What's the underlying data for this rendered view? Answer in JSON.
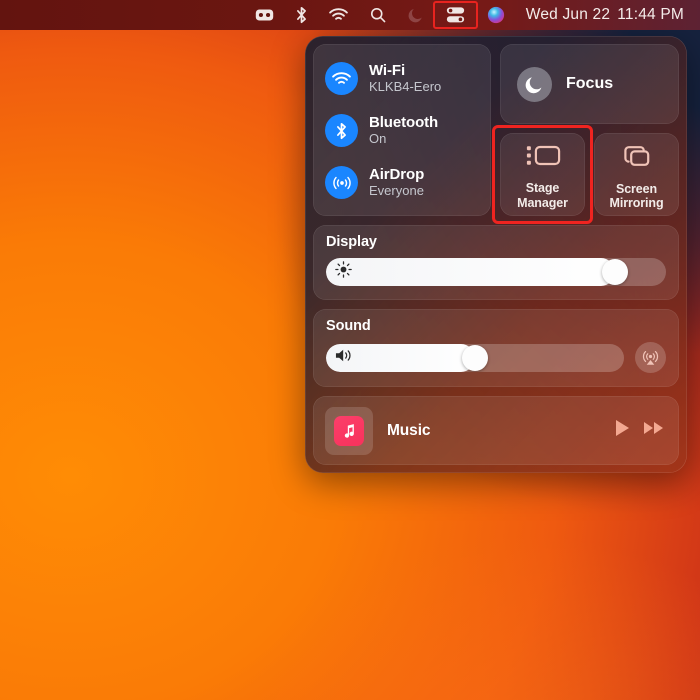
{
  "menubar": {
    "icons": [
      {
        "name": "vpn-icon",
        "label": "VPN"
      },
      {
        "name": "bluetooth-icon",
        "label": "Bluetooth"
      },
      {
        "name": "wifi-icon",
        "label": "Wi-Fi"
      },
      {
        "name": "search-icon",
        "label": "Spotlight Search"
      },
      {
        "name": "do-not-disturb-icon",
        "label": "Do Not Disturb"
      },
      {
        "name": "control-center-icon",
        "label": "Control Center"
      },
      {
        "name": "siri-icon",
        "label": "Siri"
      }
    ],
    "clock_date": "Wed Jun 22",
    "clock_time": "11:44 PM",
    "highlight_color": "#e8231f"
  },
  "control_center": {
    "connectivity": [
      {
        "name": "wifi",
        "title": "Wi-Fi",
        "subtitle": "KLKB4-Eero",
        "icon": "wifi-icon",
        "color": "#1a86ff"
      },
      {
        "name": "bluetooth",
        "title": "Bluetooth",
        "subtitle": "On",
        "icon": "bluetooth-icon",
        "color": "#1a86ff"
      },
      {
        "name": "airdrop",
        "title": "AirDrop",
        "subtitle": "Everyone",
        "icon": "airdrop-icon",
        "color": "#1a86ff"
      }
    ],
    "focus": {
      "label": "Focus",
      "icon": "moon-icon"
    },
    "tiles": [
      {
        "name": "stage-manager",
        "line1": "Stage",
        "line2": "Manager",
        "icon": "stage-manager-icon",
        "highlighted": true
      },
      {
        "name": "screen-mirroring",
        "line1": "Screen",
        "line2": "Mirroring",
        "icon": "screen-mirroring-icon",
        "highlighted": false
      }
    ],
    "display": {
      "title": "Display",
      "icon": "brightness-icon",
      "value": 88
    },
    "sound": {
      "title": "Sound",
      "icon": "volume-icon",
      "value": 50,
      "airplay_icon": "airplay-audio-icon"
    },
    "music": {
      "name": "Music",
      "app_icon": "music-note-icon",
      "play_label": "Play",
      "next_label": "Next",
      "play_icon": "play-icon",
      "next_icon": "fast-forward-icon"
    }
  }
}
